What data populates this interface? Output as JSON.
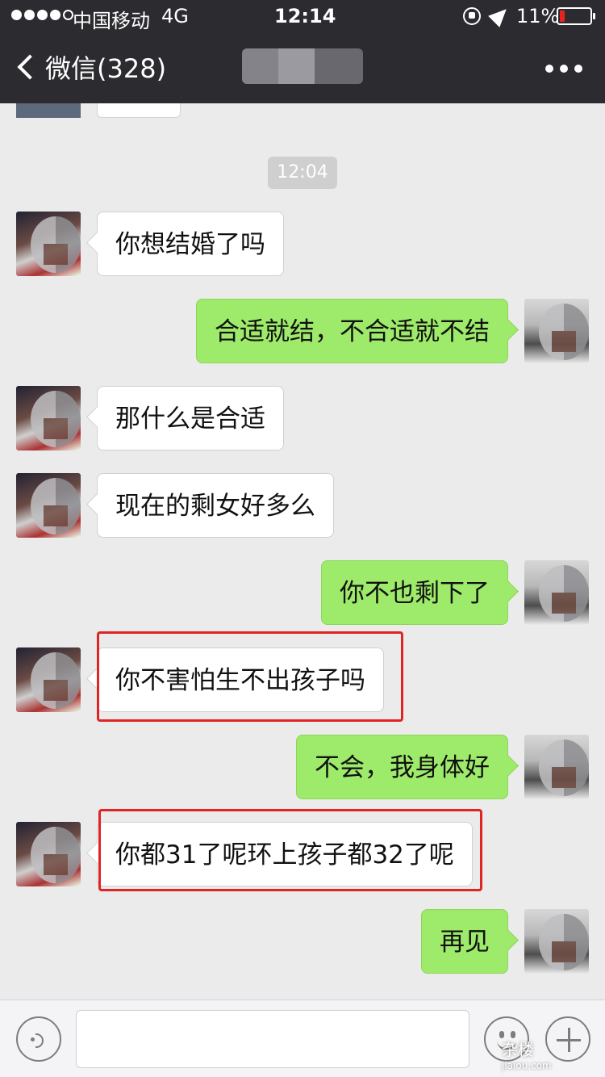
{
  "status": {
    "carrier": "中国移动",
    "network": "4G",
    "time": "12:14",
    "battery_percent": "11%",
    "battery_level": 0.11,
    "signal_bars_filled": 4,
    "signal_bars_total": 5
  },
  "nav": {
    "back_label": "微信(328)"
  },
  "chat": {
    "timestamp": "12:04",
    "messages": [
      {
        "from": "other",
        "text": "你想结婚了吗"
      },
      {
        "from": "me",
        "text": "合适就结，不合适就不结"
      },
      {
        "from": "other",
        "text": "那什么是合适"
      },
      {
        "from": "other",
        "text": "现在的剩女好多么"
      },
      {
        "from": "me",
        "text": "你不也剩下了"
      },
      {
        "from": "other",
        "text": "你不害怕生不出孩子吗",
        "highlighted": true
      },
      {
        "from": "me",
        "text": "不会，我身体好"
      },
      {
        "from": "other",
        "text": "你都31了呢环上孩子都32了呢",
        "highlighted": true
      },
      {
        "from": "me",
        "text": "再见"
      }
    ]
  },
  "input": {
    "value": ""
  },
  "watermark": {
    "main": "杂楼",
    "sub": "jiaiou.com"
  },
  "colors": {
    "topbar": "#2b2b30",
    "chat_bg": "#ebebeb",
    "my_bubble": "#9eea6a",
    "other_bubble": "#ffffff",
    "highlight": "#e02424"
  }
}
